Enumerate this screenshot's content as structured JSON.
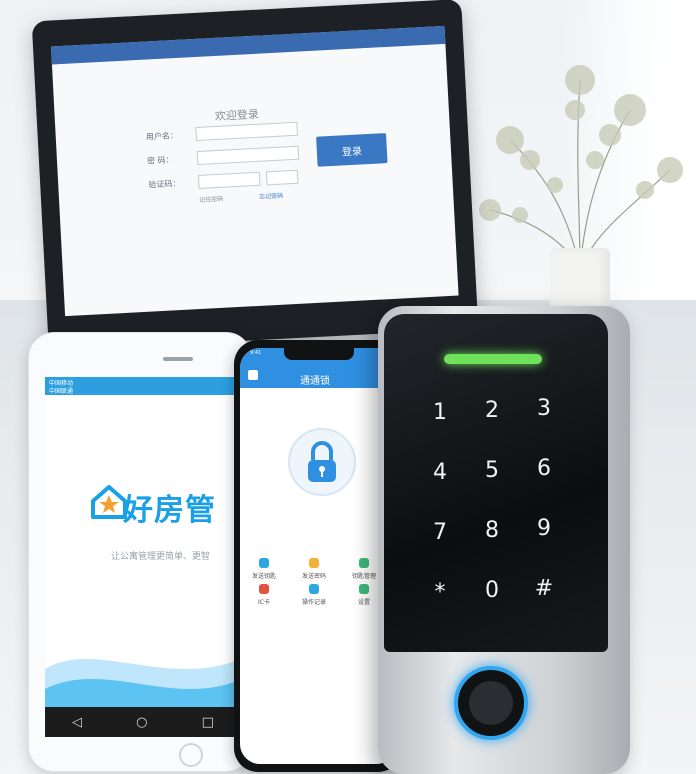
{
  "laptop": {
    "login_title": "欢迎登录",
    "label_user": "用户名：",
    "label_pass": "密  码：",
    "label_code": "验证码：",
    "login_button": "登录",
    "remember": "记住密码",
    "forgot": "忘记密码"
  },
  "tablet": {
    "status_carrier_1": "中国移动",
    "status_carrier_2": "中国联通",
    "app_name": "好房管",
    "slogan": "让公寓管理更简单、更智",
    "nav": [
      "◁",
      "○",
      "□"
    ]
  },
  "phone": {
    "time": "9:41",
    "title": "通通锁",
    "functions": [
      {
        "label": "发送钥匙",
        "color": "#2ea6e0"
      },
      {
        "label": "发送密码",
        "color": "#f2b233"
      },
      {
        "label": "钥匙管理",
        "color": "#3cb878"
      },
      {
        "label": "IC卡",
        "color": "#e2523d"
      },
      {
        "label": "操作记录",
        "color": "#2ea6e0"
      },
      {
        "label": "设置",
        "color": "#3cb878"
      }
    ]
  },
  "keypad": {
    "keys": [
      "1",
      "2",
      "3",
      "4",
      "5",
      "6",
      "7",
      "8",
      "9",
      "*",
      "0",
      "#"
    ],
    "led_color": "#6ee05a",
    "ring_color": "#33a6f0"
  }
}
